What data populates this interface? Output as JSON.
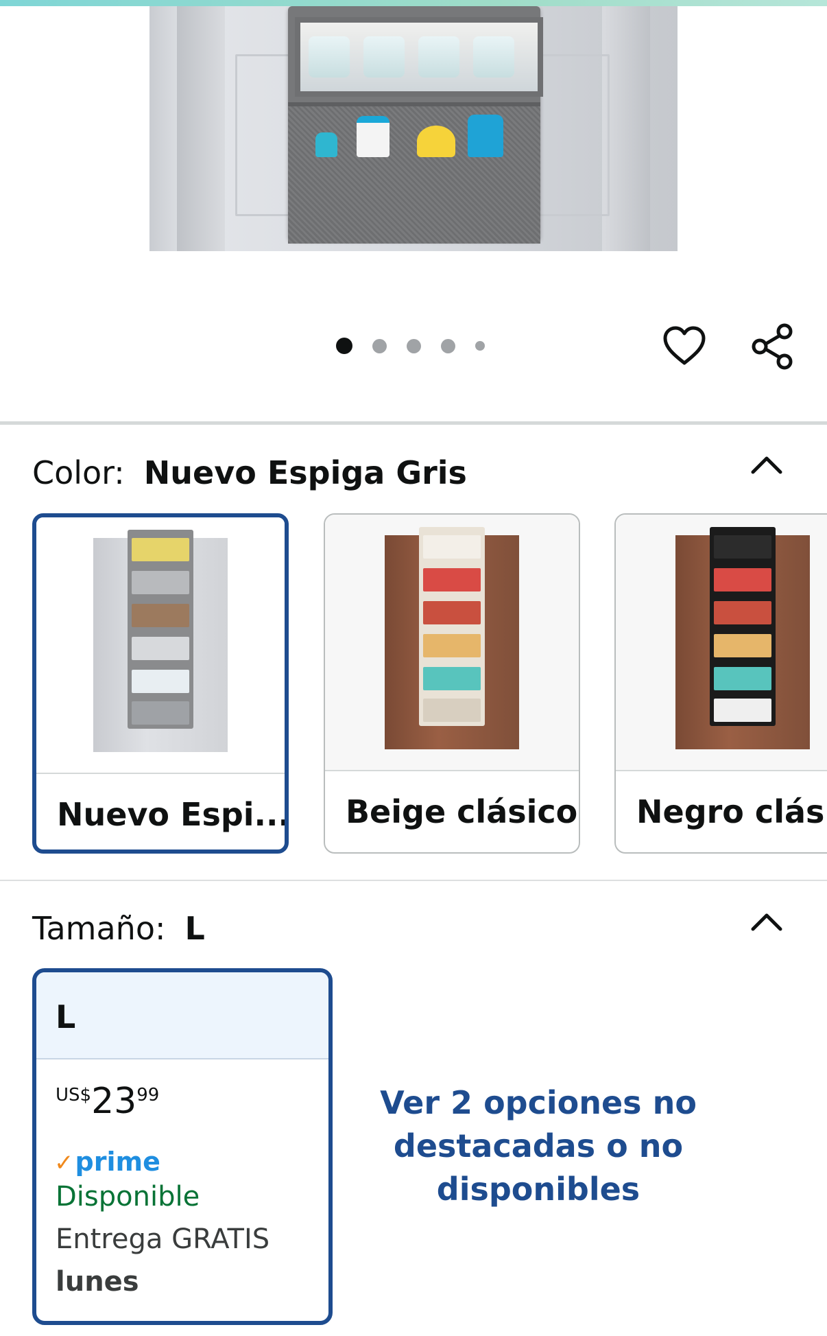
{
  "product_images": {
    "dot_count": 5,
    "active_index": 0
  },
  "actions": {
    "wishlist_icon": "heart-icon",
    "share_icon": "share-icon"
  },
  "color": {
    "label": "Color:",
    "selected": "Nuevo Espiga Gris",
    "options": [
      {
        "label": "Nuevo Espi...",
        "selected": true
      },
      {
        "label": "Beige clásico",
        "selected": false
      },
      {
        "label": "Negro clásic",
        "selected": false
      }
    ]
  },
  "size": {
    "label": "Tamaño:",
    "selected": "L",
    "option": {
      "name": "L",
      "currency": "US$",
      "price_whole": "23",
      "price_fraction": "99",
      "prime": "prime",
      "availability": "Disponible",
      "delivery": "Entrega GRATIS",
      "delivery_day": "lunes"
    },
    "more_options_link": "Ver 2 opciones no destacadas o no disponibles"
  },
  "colors": {
    "selected_border": "#1e4c8f",
    "link": "#1e4c8f",
    "available": "#087336",
    "prime": "#1f8ee0"
  }
}
